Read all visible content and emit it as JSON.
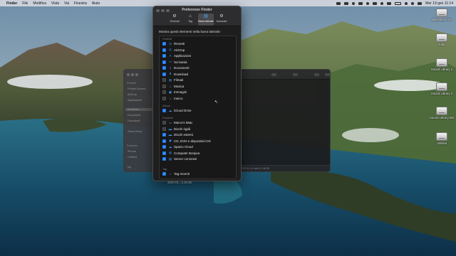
{
  "menubar": {
    "app_name": "Finder",
    "items": [
      "File",
      "Modifica",
      "Vista",
      "Vai",
      "Finestra",
      "Aiuto"
    ],
    "clock": "Mer 19 gen  11:14"
  },
  "desktop": {
    "drives": [
      "Macintosh HD",
      "Audio",
      "Sound Library 1",
      "Sound Library 2",
      "Sound Library M2",
      "Untitled"
    ],
    "screenshot_label_1": "Schermata",
    "screenshot_label_2": "2022-01...2.48.35"
  },
  "finder_window": {
    "sections": [
      "Preferiti",
      "Posizioni",
      "Tag"
    ],
    "items": [
      "Private Docum...",
      "AirDrop",
      "Applicazioni",
      "Scrivania",
      "Documenti",
      "Download",
      "iCloud Drive",
      "iPhone",
      "Untitled"
    ],
    "pathbar": "Macintosh HD > ... > 2022-01-19 alle 11.48.35"
  },
  "preferences": {
    "title": "Preferenze Finder",
    "tabs": [
      {
        "label": "Generali",
        "icon": "gear-icon"
      },
      {
        "label": "Tag",
        "icon": "tag-icon"
      },
      {
        "label": "Barra laterale",
        "icon": "sidebar-icon",
        "active": true
      },
      {
        "label": "Avanzate",
        "icon": "gears-icon"
      }
    ],
    "heading": "Mostra questi elementi nella barra laterale:",
    "sections": {
      "favorites": "Preferiti",
      "icloud": "iCloud",
      "locations": "Posizioni",
      "tags": "Tag"
    },
    "favorites": [
      {
        "label": "Recenti",
        "checked": true,
        "icon": "clock-icon"
      },
      {
        "label": "AirDrop",
        "checked": true,
        "icon": "airdrop-icon"
      },
      {
        "label": "Applicazioni",
        "checked": true,
        "icon": "apps-icon"
      },
      {
        "label": "Scrivania",
        "checked": true,
        "icon": "desktop-icon"
      },
      {
        "label": "Documenti",
        "checked": true,
        "icon": "document-icon"
      },
      {
        "label": "Download",
        "checked": true,
        "icon": "download-icon"
      },
      {
        "label": "Filmati",
        "checked": false,
        "icon": "film-icon"
      },
      {
        "label": "Musica",
        "checked": false,
        "icon": "music-icon"
      },
      {
        "label": "Immagini",
        "checked": false,
        "icon": "photo-icon"
      },
      {
        "label": "marco",
        "checked": false,
        "icon": "home-icon"
      }
    ],
    "icloud_items": [
      {
        "label": "iCloud Drive",
        "checked": true,
        "icon": "cloud-icon"
      }
    ],
    "locations": [
      {
        "label": "Marco's iMac",
        "checked": false,
        "icon": "computer-icon"
      },
      {
        "label": "Dischi rigidi",
        "checked": false,
        "icon": "harddisk-icon"
      },
      {
        "label": "Dischi esterni",
        "checked": true,
        "icon": "external-disk-icon"
      },
      {
        "label": "CD, DVD e dispositivi iOS",
        "checked": true,
        "icon": "disc-icon"
      },
      {
        "label": "Spazio Cloud",
        "checked": true,
        "icon": "cloud-storage-icon"
      },
      {
        "label": "Computer Bonjour",
        "checked": true,
        "icon": "bonjour-icon"
      },
      {
        "label": "Server connessi",
        "checked": true,
        "icon": "server-icon"
      }
    ],
    "tag_items": [
      {
        "label": "Tag recenti",
        "checked": true,
        "icon": "tag-icon"
      }
    ]
  }
}
